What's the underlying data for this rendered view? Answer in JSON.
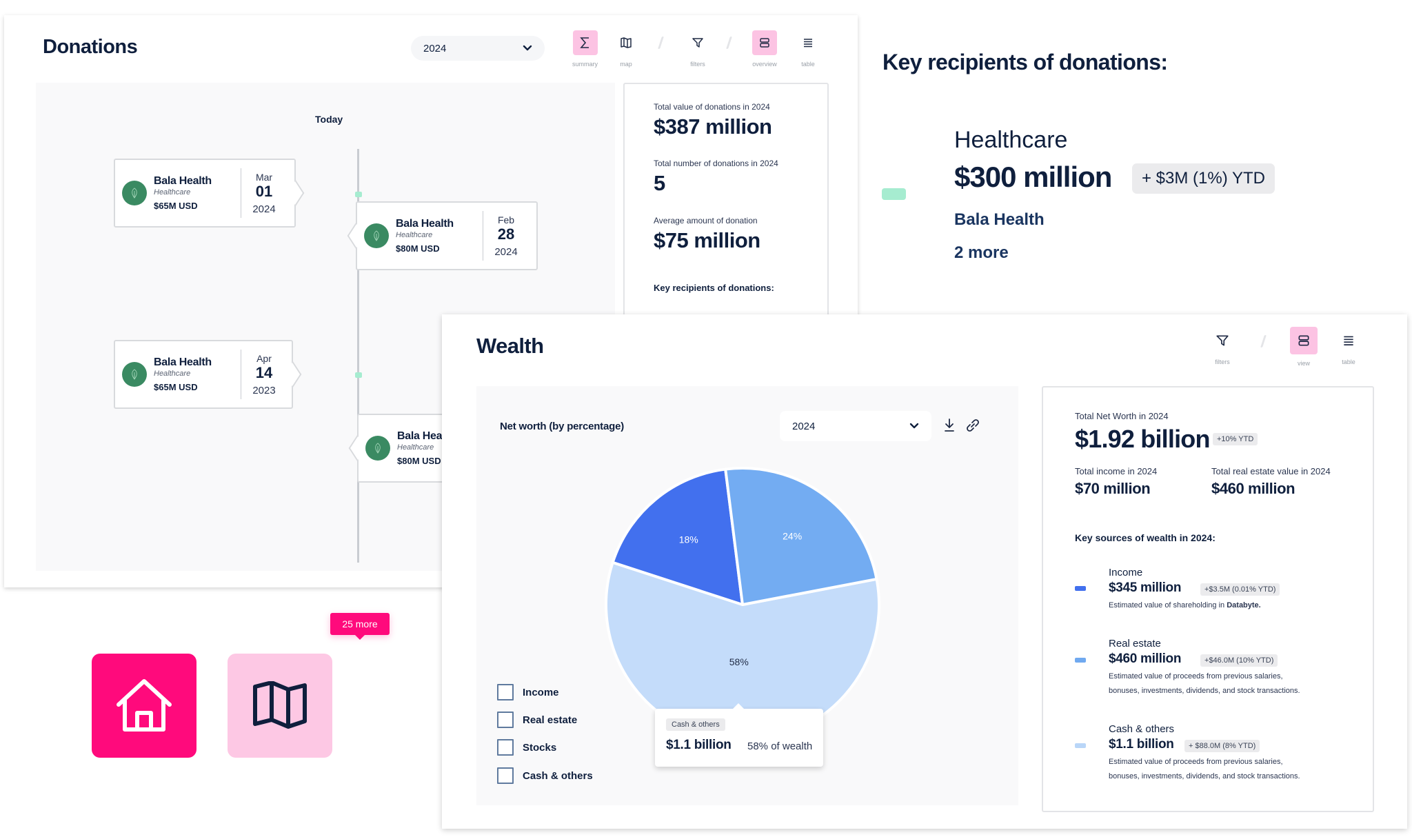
{
  "donations": {
    "title": "Donations",
    "year_select": {
      "value": "2024"
    },
    "toolbar": [
      {
        "id": "summary",
        "label": "summary",
        "icon": "sigma-icon",
        "active": true
      },
      {
        "id": "map",
        "label": "map",
        "icon": "map-icon",
        "active": false
      },
      {
        "id": "filters",
        "label": "filters",
        "icon": "filter-icon",
        "active": false
      },
      {
        "id": "overview",
        "label": "overview",
        "icon": "rows-icon",
        "active": true
      },
      {
        "id": "table",
        "label": "table",
        "icon": "list-icon",
        "active": false
      }
    ],
    "timeline": {
      "today_label": "Today",
      "items": [
        {
          "name": "Bala Health",
          "category": "Healthcare",
          "amount": "$65M USD",
          "month": "Mar",
          "day": "01",
          "year": "2024",
          "side": "left"
        },
        {
          "name": "Bala Health",
          "category": "Healthcare",
          "amount": "$80M USD",
          "month": "Feb",
          "day": "28",
          "year": "2024",
          "side": "right"
        },
        {
          "name": "Bala Health",
          "category": "Healthcare",
          "amount": "$65M USD",
          "month": "Apr",
          "day": "14",
          "year": "2023",
          "side": "left"
        },
        {
          "name": "Bala Health",
          "category": "Healthcare",
          "amount": "$80M USD",
          "month": "",
          "day": "",
          "year": "",
          "side": "right"
        }
      ],
      "more_label": "25 more"
    },
    "summary": {
      "total_value_label": "Total value of donations in 2024",
      "total_value": "$387 million",
      "total_count_label": "Total number of donations in 2024",
      "total_count": "5",
      "average_label": "Average amount of donation",
      "average": "$75 million",
      "key_recipients_label": "Key recipients of donations:"
    }
  },
  "key_recipients": {
    "title": "Key recipients of donations:",
    "category": "Healthcare",
    "value": "$300 million",
    "ytd_badge": "+ $3M (1%) YTD",
    "recipient": "Bala Health",
    "more": "2 more",
    "swatch_color": "#a6ecd0"
  },
  "wealth": {
    "title": "Wealth",
    "toolbar": [
      {
        "id": "filters",
        "label": "filters",
        "icon": "filter-icon",
        "active": false
      },
      {
        "id": "view",
        "label": "view",
        "icon": "rows-icon",
        "active": true
      },
      {
        "id": "table",
        "label": "table",
        "icon": "list-icon",
        "active": false
      }
    ],
    "chart_header": {
      "title": "Net worth (by percentage)",
      "year": "2024"
    },
    "legend": [
      "Income",
      "Real estate",
      "Stocks",
      "Cash & others"
    ],
    "tooltip": {
      "tag": "Cash & others",
      "value": "$1.1 billion",
      "pct": "58% of wealth"
    },
    "summary": {
      "net_worth_label": "Total Net Worth in 2024",
      "net_worth": "$1.92 billion",
      "net_worth_ytd": "+10% YTD",
      "income_label": "Total income in 2024",
      "income": "$70 million",
      "real_estate_label": "Total real estate value in 2024",
      "real_estate": "$460 million",
      "sources_label": "Key sources of wealth in 2024:",
      "sources": [
        {
          "name": "Income",
          "value": "$345 million",
          "ytd": "+$3.5M (0.01% YTD)",
          "desc_prefix": "Estimated value of shareholding in ",
          "desc_bold": "Databyte.",
          "desc_line2": "",
          "color": "#4270ee"
        },
        {
          "name": "Real estate",
          "value": "$460 million",
          "ytd": "+$46.0M (10% YTD)",
          "desc_prefix": "Estimated value of proceeds from previous salaries,",
          "desc_bold": "",
          "desc_line2": "bonuses, investments, dividends, and stock transactions.",
          "color": "#70a9f0"
        },
        {
          "name": "Cash & others",
          "value": "$1.1 billion",
          "ytd": "+ $88.0M (8% YTD)",
          "desc_prefix": "Estimated value of proceeds from previous salaries,",
          "desc_bold": "",
          "desc_line2": "bonuses, investments, dividends, and stock transactions.",
          "color": "#b9d6f8"
        }
      ]
    }
  },
  "nav_tiles": [
    {
      "id": "home",
      "icon": "home-icon",
      "active": true
    },
    {
      "id": "map",
      "icon": "map-icon",
      "active": false
    }
  ],
  "chart_data": {
    "type": "pie",
    "title": "Net worth (by percentage)",
    "categories": [
      "Cash & others",
      "Income",
      "Real estate"
    ],
    "values": [
      58,
      18,
      24
    ],
    "labels": [
      "58%",
      "18%",
      "24%"
    ],
    "colors": [
      "#c4dcfa",
      "#4270ee",
      "#73acf2"
    ],
    "unit": "percent",
    "legend": "left"
  }
}
